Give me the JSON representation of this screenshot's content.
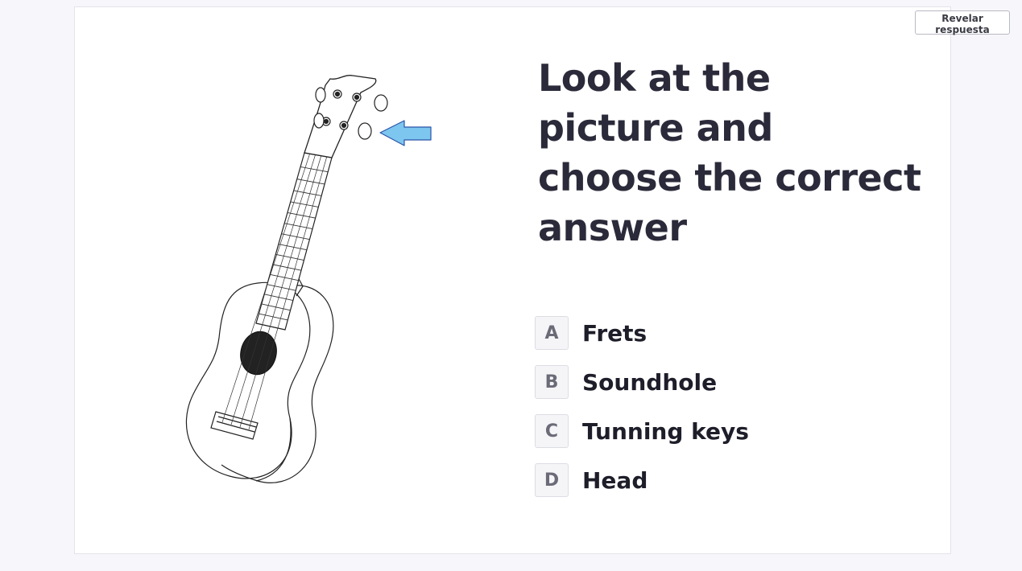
{
  "reveal_button": {
    "label": "Revelar respuesta"
  },
  "question": {
    "title": "Look at the picture and choose the correct answer"
  },
  "illustration": {
    "subject": "ukulele-drawing",
    "pointer": "arrow-pointing-at-tuning-key",
    "arrow_color": "#7cc6ef"
  },
  "options": [
    {
      "letter": "A",
      "text": "Frets"
    },
    {
      "letter": "B",
      "text": "Soundhole"
    },
    {
      "letter": "C",
      "text": "Tunning keys"
    },
    {
      "letter": "D",
      "text": "Head"
    }
  ]
}
